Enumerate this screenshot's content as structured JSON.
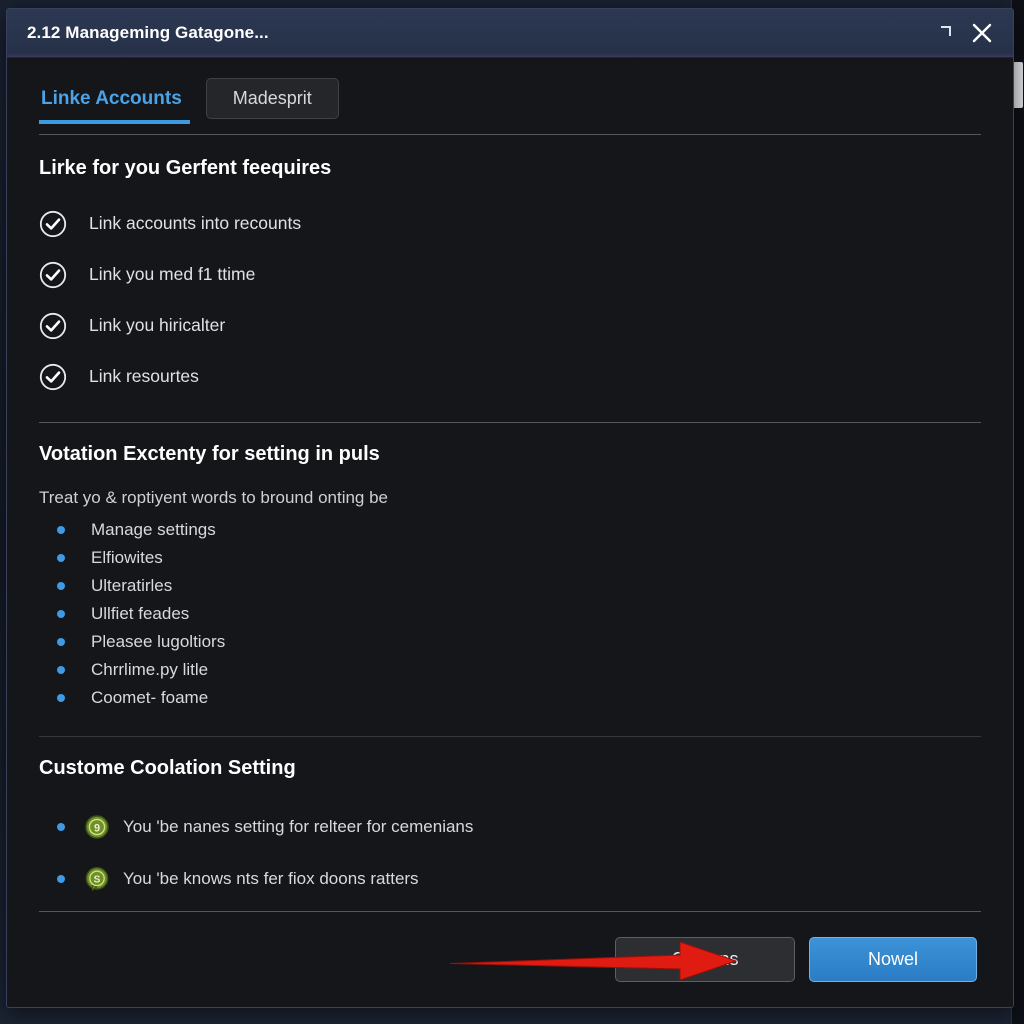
{
  "window": {
    "title": "2.12 Manageming Gatagone...",
    "restore_icon": "restore-window-icon",
    "close_icon": "close-icon"
  },
  "tabs": {
    "active": "Linke Accounts",
    "secondary": "Madesprit"
  },
  "sections": [
    {
      "heading": "Lirke for you Gerfent feequires",
      "items": [
        "Link accounts into recounts",
        "Link you med f1 ttime",
        "Link you hiricalter",
        "Link resourtes"
      ]
    },
    {
      "heading": "Votation Exctenty for setting in puls",
      "intro": "Treat yo & roptiyent words to bround onting be",
      "bullets": [
        "Manage settings",
        "Elfiowites",
        "Ulteratirles",
        "Ullfiet feades",
        "Pleasee lugoltiors",
        "Chrrlime.py litle",
        "Coomet- foame"
      ]
    },
    {
      "heading": "Custome Coolation Setting",
      "badges": [
        "You 'be nanes setting for relteer for cemenians",
        "You 'be knows nts fer fiox doons ratters"
      ]
    }
  ],
  "footer": {
    "secondary_button": "Contons",
    "primary_button": "Nowel"
  },
  "colors": {
    "accent_blue": "#3d9ae0",
    "primary_button": "#2a7dc4",
    "badge_green": "#6b8e23",
    "annotation_red": "#e02020",
    "titlebar_navy": "#2c3852"
  }
}
